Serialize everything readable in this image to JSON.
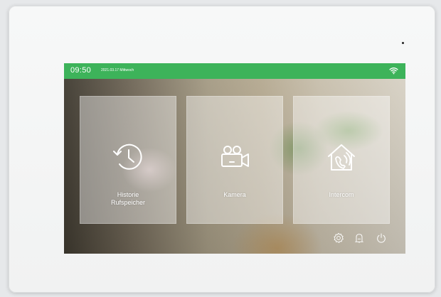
{
  "statusbar": {
    "time": "09:50",
    "date": "2021.03.17 Mittwoch",
    "wifi_icon": "wifi-icon",
    "color": "#3db35a"
  },
  "tiles": [
    {
      "label_line1": "Historie",
      "label_line2": "Rufspeicher",
      "icon": "clock-history-icon"
    },
    {
      "label_line1": "Kamera",
      "label_line2": "",
      "icon": "video-camera-icon"
    },
    {
      "label_line1": "Intercom",
      "label_line2": "",
      "icon": "home-intercom-icon"
    }
  ],
  "bottom_bar": {
    "icons": [
      "settings-icon",
      "doorbell-icon",
      "power-icon"
    ]
  }
}
